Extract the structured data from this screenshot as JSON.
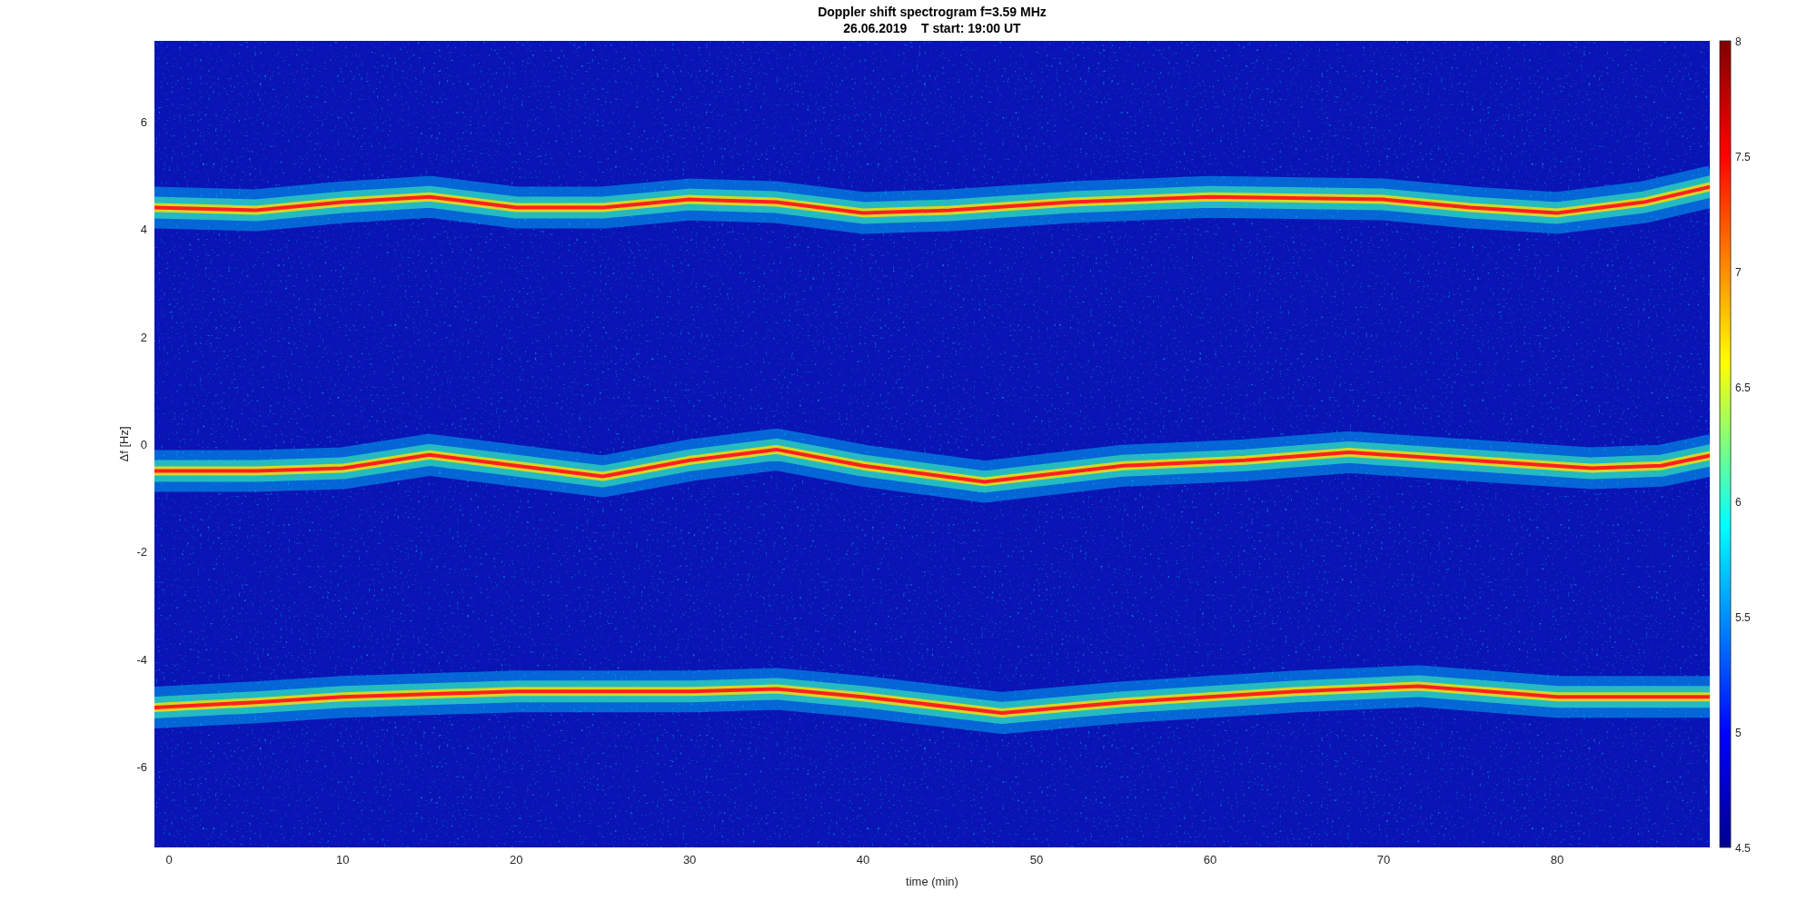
{
  "figure": {
    "title_lines": [
      "Doppler shift spectrogram f=3.59 MHz",
      "26.06.2019    T start: 19:00 UT"
    ],
    "xlabel": "time (min)",
    "ylabel": "Δf [Hz]",
    "xticks": [
      "0",
      "10",
      "20",
      "30",
      "40",
      "50",
      "60",
      "70",
      "80"
    ],
    "yticks": [
      "6",
      "4",
      "2",
      "0",
      "-2",
      "-4",
      "-6"
    ],
    "colorbar_ticks": [
      "8",
      "7.5",
      "7",
      "6.5",
      "6",
      "5.5",
      "5",
      "4.5"
    ]
  }
}
